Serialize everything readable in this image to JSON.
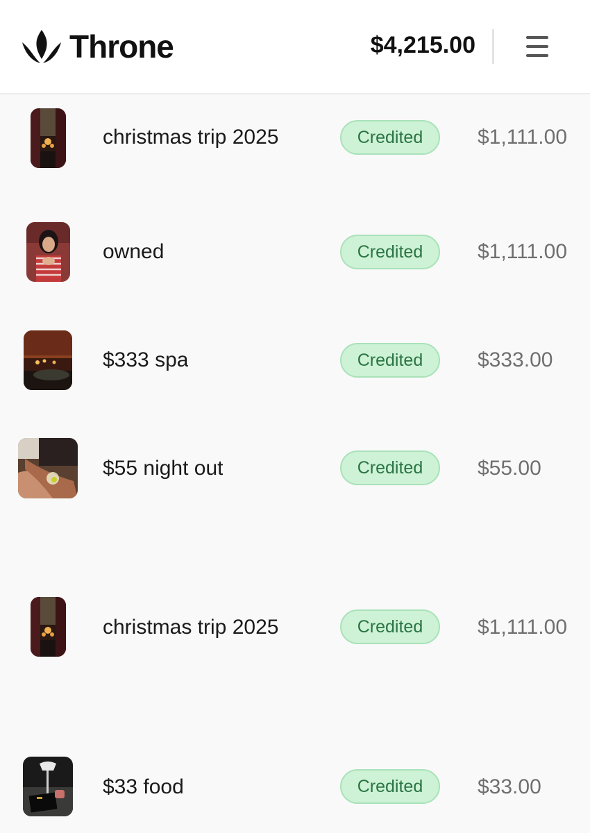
{
  "header": {
    "brand": "Throne",
    "balance": "$4,215.00",
    "menu_icon": "hamburger-menu-icon",
    "logo_icon": "crown-flame-logo-icon"
  },
  "colors": {
    "badge_bg": "#cdf2d6",
    "badge_text": "#2b7443",
    "amount_text": "#6f6f6f"
  },
  "transactions": [
    {
      "title": "christmas trip 2025",
      "status": "Credited",
      "amount": "$1,111.00",
      "thumb": "christmas-photo"
    },
    {
      "title": "owned",
      "status": "Credited",
      "amount": "$1,111.00",
      "thumb": "portrait-photo"
    },
    {
      "title": "$333 spa",
      "status": "Credited",
      "amount": "$333.00",
      "thumb": "spa-photo"
    },
    {
      "title": "$55 night out",
      "status": "Credited",
      "amount": "$55.00",
      "thumb": "night-out-photo"
    },
    {
      "title": "christmas trip 2025",
      "status": "Credited",
      "amount": "$1,111.00",
      "thumb": "christmas-photo"
    },
    {
      "title": "$33 food",
      "status": "Credited",
      "amount": "$33.00",
      "thumb": "food-photo"
    }
  ]
}
